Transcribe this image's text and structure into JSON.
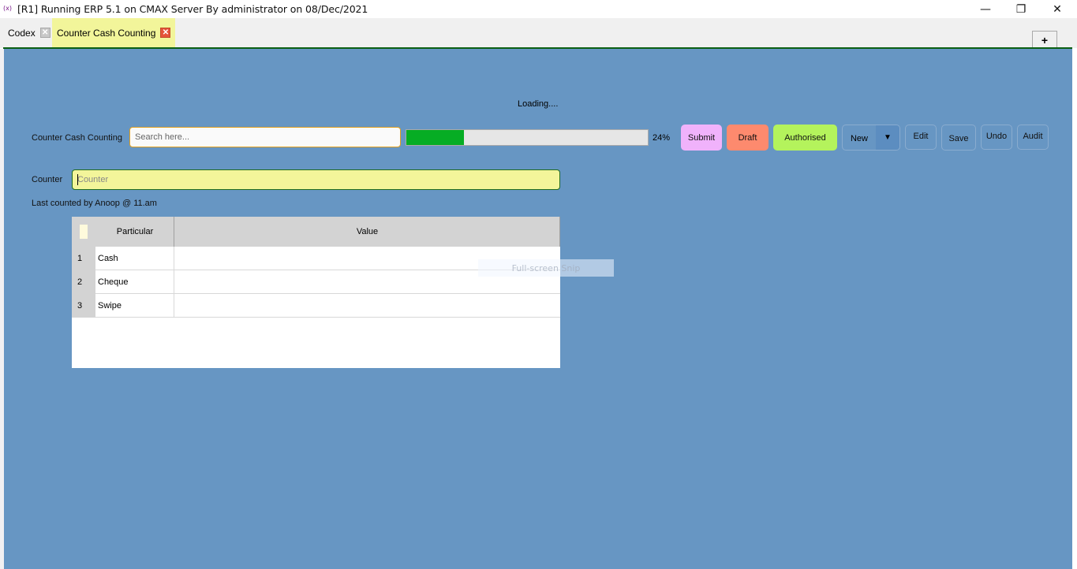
{
  "window": {
    "app_icon": "(x)",
    "title": "[R1] Running ERP 5.1 on CMAX Server By administrator on 08/Dec/2021",
    "controls": {
      "minimize": "—",
      "restore": "❐",
      "close": "✕"
    }
  },
  "tabs": [
    {
      "label": "Codex",
      "active": false,
      "close_glyph": "✕"
    },
    {
      "label": "Counter Cash Counting",
      "active": true,
      "close_glyph": "✕"
    }
  ],
  "add_tab_label": "+",
  "form": {
    "loading_text": "Loading....",
    "title_label": "Counter Cash Counting",
    "search_placeholder": "Search here...",
    "progress": {
      "percent": 24,
      "label": "24%",
      "fill_color": "#06ad24"
    },
    "buttons": {
      "submit": {
        "label": "Submit",
        "color": "#f0b2fb"
      },
      "draft": {
        "label": "Draft",
        "color": "#fd8a6e"
      },
      "authorised": {
        "label": "Authorised",
        "color": "#b4f35c"
      },
      "new": {
        "label": "New",
        "dropdown_glyph": "▼"
      },
      "edit": {
        "label": "Edit"
      },
      "save": {
        "label": "Save"
      },
      "undo": {
        "label": "Undo"
      },
      "audit": {
        "label": "Audit"
      }
    },
    "counter_label": "Counter",
    "counter_placeholder": "Counter",
    "counter_value": "",
    "last_counted": "Last counted by Anoop @ 11.am"
  },
  "grid": {
    "columns": [
      "Particular",
      "Value"
    ],
    "rows": [
      {
        "num": "1",
        "particular": "Cash",
        "value": ""
      },
      {
        "num": "2",
        "particular": "Cheque",
        "value": ""
      },
      {
        "num": "3",
        "particular": "Swipe",
        "value": ""
      }
    ]
  },
  "overlay": {
    "snip_text": "Full-screen Snip"
  },
  "colors": {
    "background": "#6796c3",
    "active_tab": "#f2f59a",
    "accent_line": "#0b5f14"
  }
}
